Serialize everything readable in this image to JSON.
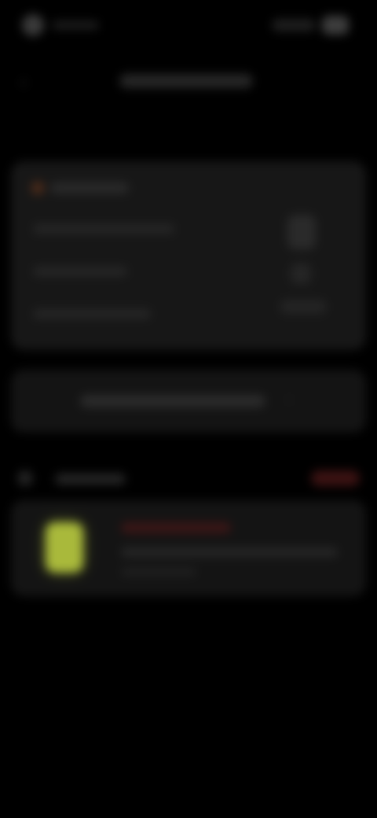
{
  "status_bar": {
    "time": "",
    "battery_icon": "battery-icon"
  },
  "top_bar": {
    "back_icon": "chevron-left-icon",
    "title": ""
  },
  "summary_card": {
    "tag_icon": "tag-icon",
    "tag_label": "",
    "lines": [
      "",
      "",
      ""
    ],
    "side_values": [
      "",
      "",
      ""
    ]
  },
  "action_row": {
    "label": "",
    "chevron_icon": "chevron-right-icon"
  },
  "section": {
    "icon": "list-icon",
    "title": "",
    "link_label": ""
  },
  "list_item": {
    "title": "",
    "subtitle": "",
    "meta": ""
  },
  "colors": {
    "background": "#000000",
    "card": "#171717",
    "accent_lime": "#a9b93b",
    "accent_red": "#3b1212"
  }
}
